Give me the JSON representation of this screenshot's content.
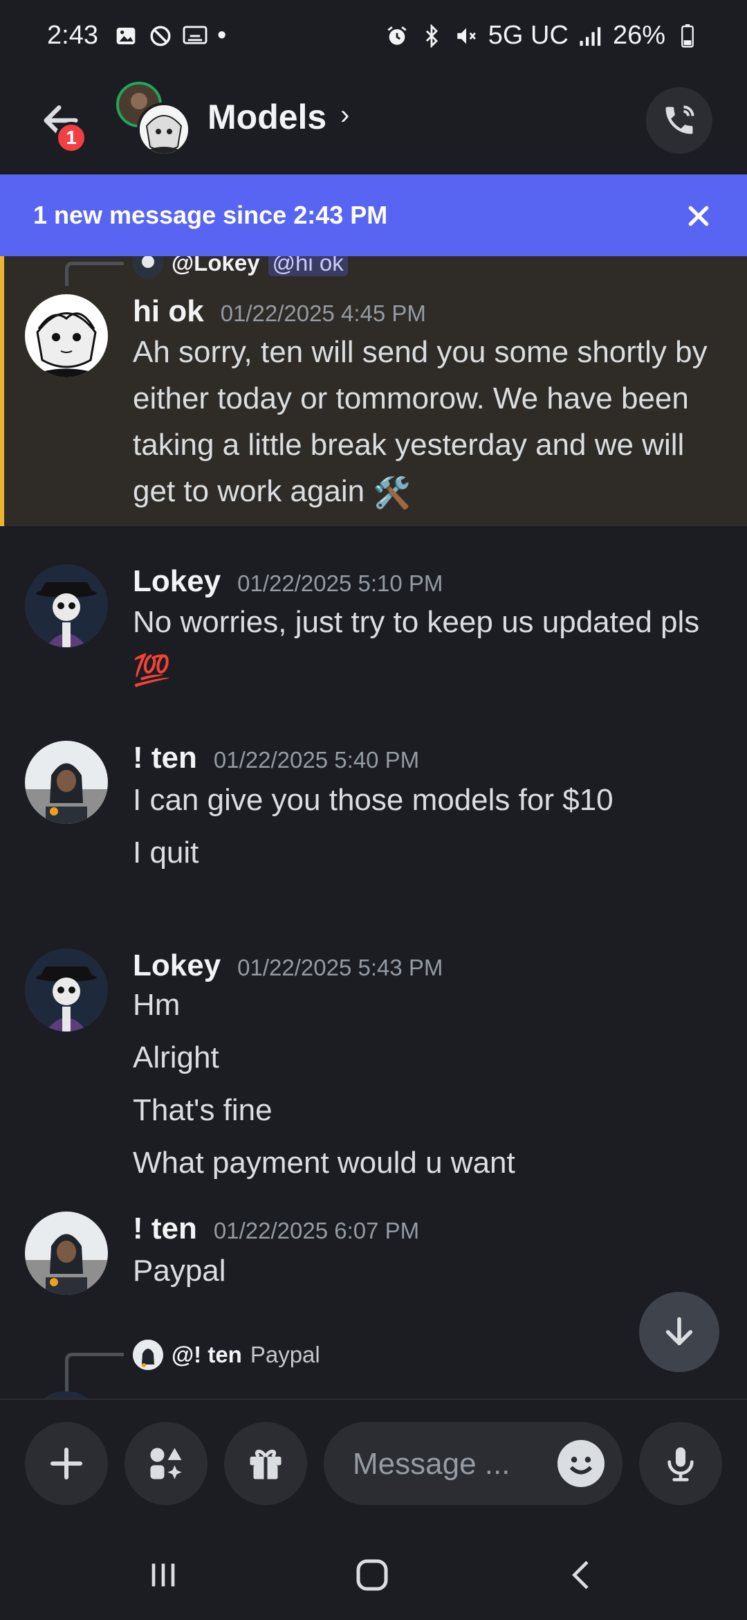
{
  "status_bar": {
    "time": "2:43",
    "network": "5G UC",
    "battery": "26%",
    "dot": "•"
  },
  "header": {
    "title": "Models",
    "chevron": "›",
    "unread_badge": "1"
  },
  "banner": {
    "text": "1 new message since 2:43 PM"
  },
  "messages": [
    {
      "reply_to": {
        "name": "@Lokey",
        "text": "@hi ok"
      },
      "author": "hi ok",
      "timestamp": "01/22/2025 4:45 PM",
      "lines": [
        "Ah sorry, ten will send you some shortly by either today or tommorow. We have been taking a little break yesterday and we will get to work again"
      ],
      "emoji": "🛠️"
    },
    {
      "author": "Lokey",
      "timestamp": "01/22/2025 5:10 PM",
      "lines": [
        "No worries, just try to keep us updated pls"
      ],
      "emoji": "💯"
    },
    {
      "author": "! ten",
      "timestamp": "01/22/2025 5:40 PM",
      "lines": [
        "I can give you those models for $10",
        "I quit"
      ]
    },
    {
      "author": "Lokey",
      "timestamp": "01/22/2025 5:43 PM",
      "lines": [
        "Hm",
        "Alright",
        "That's fine",
        "What payment would u want"
      ]
    },
    {
      "author": "! ten",
      "timestamp": "01/22/2025 6:07 PM",
      "lines": [
        "Paypal"
      ]
    }
  ],
  "bottom_reply": {
    "name": "@! ten",
    "text": "Paypal"
  },
  "composer": {
    "placeholder": "Message ..."
  },
  "colors": {
    "background": "#1c1d22",
    "accent": "#5865f2",
    "highlight": "#2f2c27",
    "highlight_bar": "#f0b232",
    "badge": "#f23f43"
  }
}
